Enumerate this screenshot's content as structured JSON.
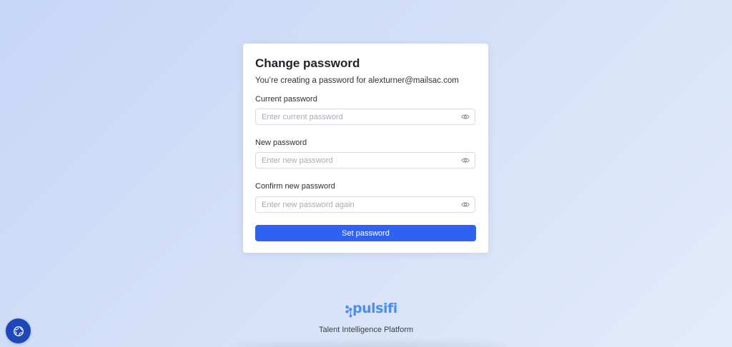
{
  "form": {
    "title": "Change password",
    "subtitle": "You’re creating a password for alexturner@mailsac.com",
    "fields": [
      {
        "label": "Current password",
        "value": "",
        "placeholder": "Enter current password",
        "icon": "eye-icon"
      },
      {
        "label": "New password",
        "value": "",
        "placeholder": "Enter new password",
        "icon": "eye-icon"
      },
      {
        "label": "Confirm new password",
        "value": "",
        "placeholder": "Enter new password again",
        "icon": "eye-icon"
      }
    ],
    "submit_label": "Set password"
  },
  "footer": {
    "logo_text": "pulsifi",
    "tagline": "Talent Intelligence Platform"
  },
  "floating_button": {
    "icon": "globe-icon"
  },
  "colors": {
    "primary": "#2d63f0",
    "logo": "#4a8ff0",
    "fab": "#1e47b8",
    "background_start": "#c6d6f6",
    "background_end": "#e3ebfb"
  }
}
